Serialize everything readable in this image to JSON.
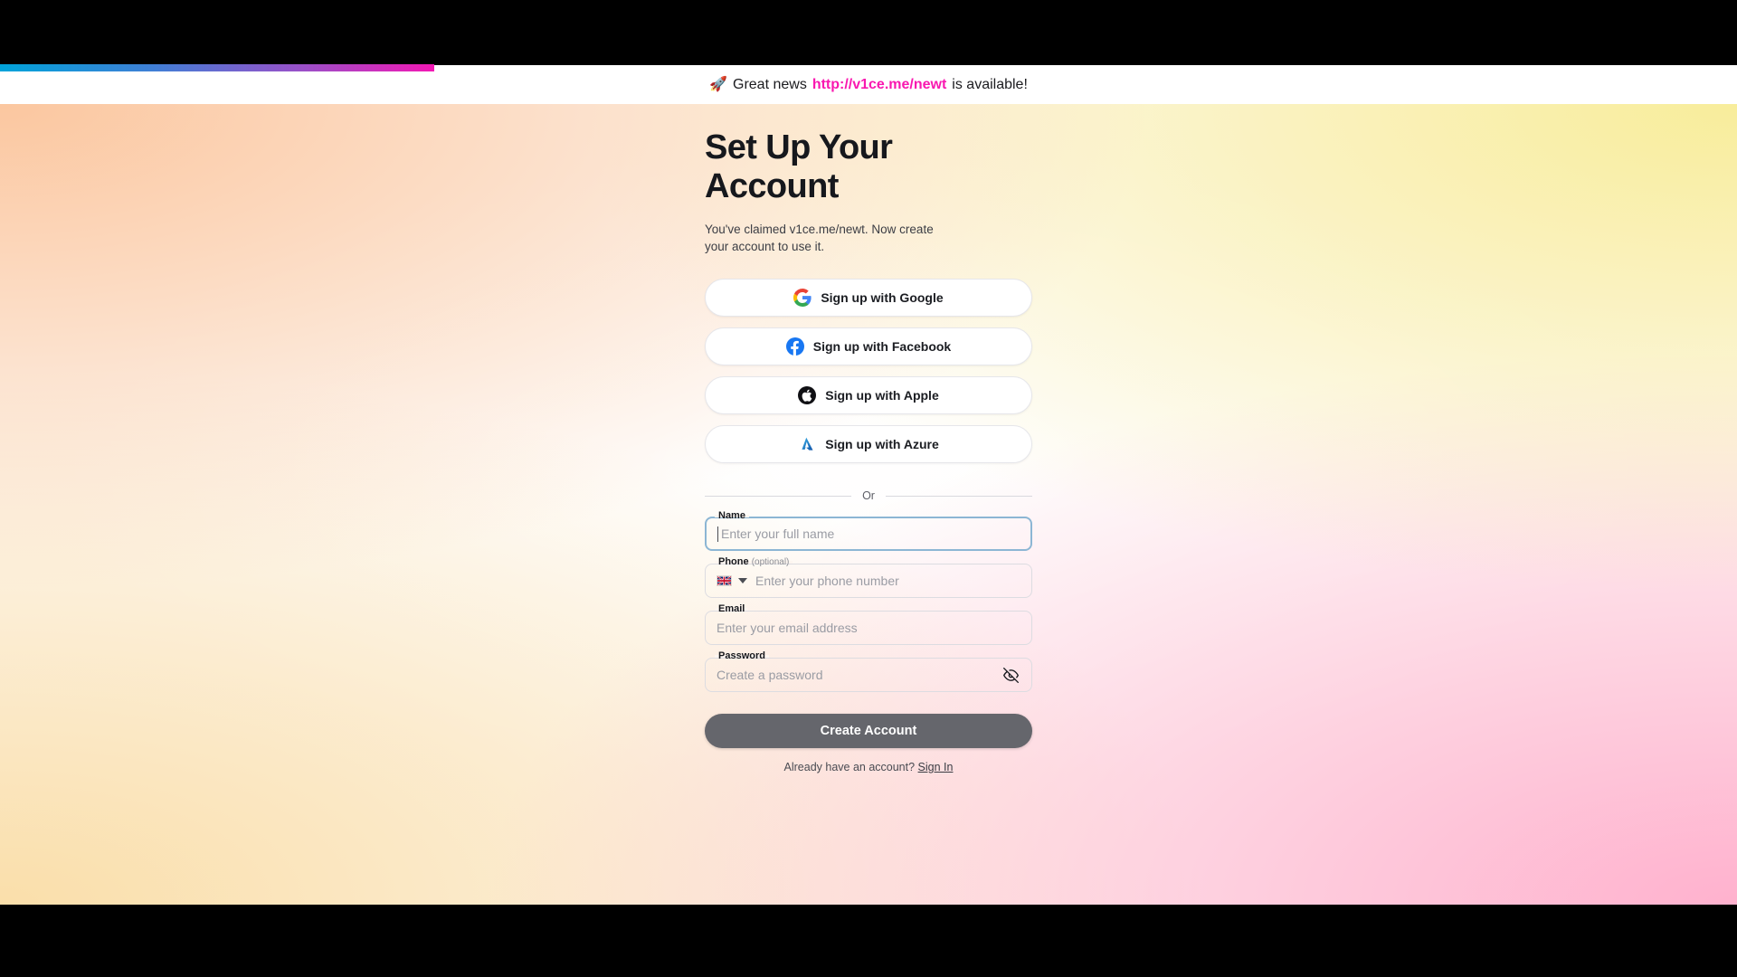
{
  "banner": {
    "icon": "rocket-icon",
    "lead_text": "Great news",
    "url_text": "http://v1ce.me/newt",
    "tail_text": "is available!",
    "url_color": "#f918b0"
  },
  "progress": {
    "percent": 25,
    "gradient_from": "#00a3d9",
    "gradient_to": "#f318b4"
  },
  "page": {
    "title": "Set Up Your Account",
    "subtitle": "You've claimed v1ce.me/newt. Now create your account to use it."
  },
  "social_buttons": [
    {
      "label": "Sign up with Google",
      "icon": "google-icon"
    },
    {
      "label": "Sign up with Facebook",
      "icon": "facebook-icon"
    },
    {
      "label": "Sign up with Apple",
      "icon": "apple-icon"
    },
    {
      "label": "Sign up with Azure",
      "icon": "azure-icon"
    }
  ],
  "divider": {
    "label": "Or"
  },
  "form": {
    "name": {
      "label": "Name",
      "placeholder": "Enter your full name",
      "value": "",
      "focused": true
    },
    "phone": {
      "label": "Phone",
      "optional_label": "(optional)",
      "placeholder": "Enter your phone number",
      "value": "",
      "country_flag": "uk-flag-icon"
    },
    "email": {
      "label": "Email",
      "placeholder": "Enter your email address",
      "value": ""
    },
    "password": {
      "label": "Password",
      "placeholder": "Create a password",
      "value": "",
      "visibility_icon": "eye-off-icon"
    }
  },
  "submit": {
    "label": "Create Account",
    "color": "#65666c"
  },
  "signin": {
    "prompt": "Already have an account?",
    "link_label": "Sign In"
  }
}
